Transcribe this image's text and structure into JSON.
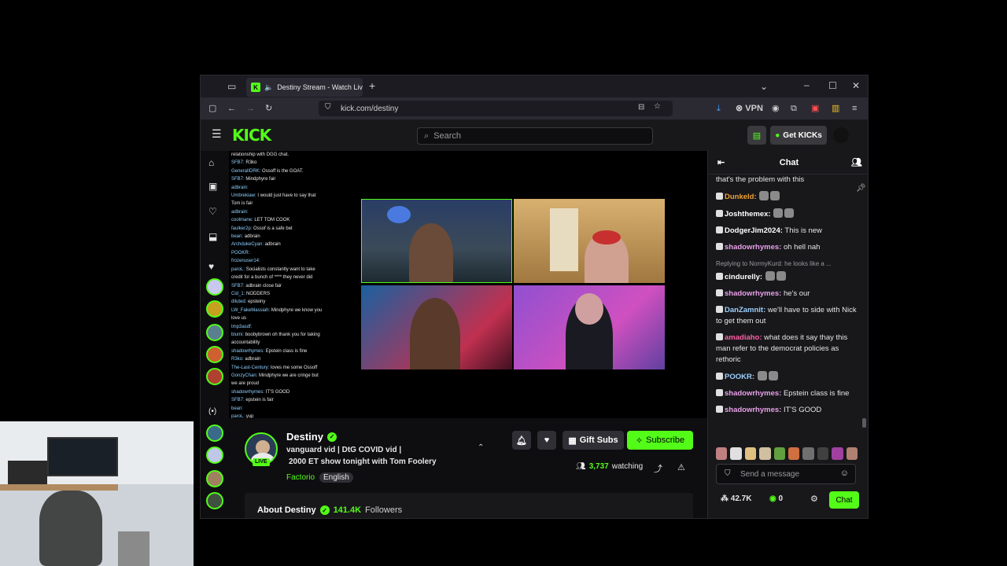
{
  "browser": {
    "tab_title": "Destiny Stream - Watch Liv",
    "url": "kick.com/destiny",
    "vpn_label": "VPN"
  },
  "header": {
    "logo": "KICK",
    "search_placeholder": "Search",
    "get_kicks_label": "Get KICKs"
  },
  "stream_overlay_chat": [
    {
      "user": "",
      "text": "relationship with DGG chat."
    },
    {
      "user": "SFB7:",
      "text": "R3ko"
    },
    {
      "user": "GeneralIDRK:",
      "text": "Ossoff is the GOAT."
    },
    {
      "user": "SFB7:",
      "text": "Mindphyre  fair"
    },
    {
      "user": "adbrain:",
      "text": ""
    },
    {
      "user": "Umbrekiaw:",
      "text": "I would just have to say that"
    },
    {
      "user": "",
      "text": "Tom is fair"
    },
    {
      "user": "adbrain:",
      "text": ""
    },
    {
      "user": "coolmane:",
      "text": "LET TOM COOK"
    },
    {
      "user": "faulker2p:",
      "text": "Ossof is a safe bet"
    },
    {
      "user": "bean:",
      "text": "adbrain"
    },
    {
      "user": "ArchdukeCyan:",
      "text": "adbrain"
    },
    {
      "user": "POOKR:",
      "text": ""
    },
    {
      "user": "frozenuser14:",
      "text": ""
    },
    {
      "user": "paroL:",
      "text": "Socialists constantly want to take"
    },
    {
      "user": "",
      "text": "credit for a bunch of **** they never did"
    },
    {
      "user": "SFB7:",
      "text": "adbrain close  fair"
    },
    {
      "user": "Cid_1:",
      "text": "NODDERS"
    },
    {
      "user": "diluted:",
      "text": "epsteiny"
    },
    {
      "user": "LW_FakeMassiah:",
      "text": "Mindphyre we know you"
    },
    {
      "user": "",
      "text": "love us"
    },
    {
      "user": "tmp3asdf:",
      "text": ""
    },
    {
      "user": "blumi:",
      "text": "boobybrown oh thank you for taking"
    },
    {
      "user": "",
      "text": "accountability"
    },
    {
      "user": "shadowrhymes:",
      "text": "Epstein class is fine"
    },
    {
      "user": "R3ko:",
      "text": "adbrain"
    },
    {
      "user": "The-Last-Century:",
      "text": "loves me some Ossoff"
    },
    {
      "user": "GonzyChan:",
      "text": "Mindphyre we are cringe but"
    },
    {
      "user": "",
      "text": "we are proud"
    },
    {
      "user": "shadowrhymes:",
      "text": "IT'S GOOD"
    },
    {
      "user": "SFB7:",
      "text": "epstein is fair"
    },
    {
      "user": "bean:",
      "text": ""
    },
    {
      "user": "paroL:",
      "text": "yup"
    }
  ],
  "channel": {
    "name": "Destiny",
    "live_badge": "LIVE",
    "title_line1": "vanguard vid | DtG COVID vid |",
    "title_line2": "2000 ET show tonight with Tom Foolery",
    "category": "Factorio",
    "language": "English",
    "gift_subs_label": "Gift Subs",
    "subscribe_label": "Subscribe",
    "viewer_count": "3,737",
    "viewer_suffix": "watching",
    "about_label": "About Destiny",
    "followers_count": "141.4K",
    "followers_label": "Followers"
  },
  "chat": {
    "title": "Chat",
    "messages": [
      {
        "user": "",
        "text": "that's the problem with this",
        "color": "#e6e6e6"
      },
      {
        "user": "Dunkeld:",
        "text": "",
        "color": "#f0a030"
      },
      {
        "user": "Joshthemex:",
        "text": "",
        "color": "#ffffff"
      },
      {
        "user": "DodgerJim2024:",
        "text": "This is new",
        "color": "#ffffff"
      },
      {
        "user": "shadowrhymes:",
        "text": "oh hell nah",
        "color": "#e8a0e8"
      },
      {
        "user": "cindurelly:",
        "text": "",
        "color": "#ffffff",
        "reply": "Replying to NormyKurd: he looks like a ..."
      },
      {
        "user": "shadowrhymes:",
        "text": "he's our",
        "color": "#e8a0e8"
      },
      {
        "user": "DanZamnit:",
        "text": "we'll have to side with Nick to get them out",
        "color": "#9ad0ff"
      },
      {
        "user": "amadiaho:",
        "text": "what does it say thay this man refer to the democrat policies as rethoric",
        "color": "#ff5fa8"
      },
      {
        "user": "POOKR:",
        "text": "",
        "color": "#9ad0ff"
      },
      {
        "user": "shadowrhymes:",
        "text": "Epstein class is fine",
        "color": "#e8a0e8"
      },
      {
        "user": "shadowrhymes:",
        "text": "IT'S GOOD",
        "color": "#e8a0e8"
      }
    ],
    "input_placeholder": "Send a message",
    "kicks_count": "42.7K",
    "points": "0",
    "send_label": "Chat"
  },
  "colors": {
    "brand": "#53fc18",
    "background": "#0e0e10",
    "panel": "#18181b"
  }
}
